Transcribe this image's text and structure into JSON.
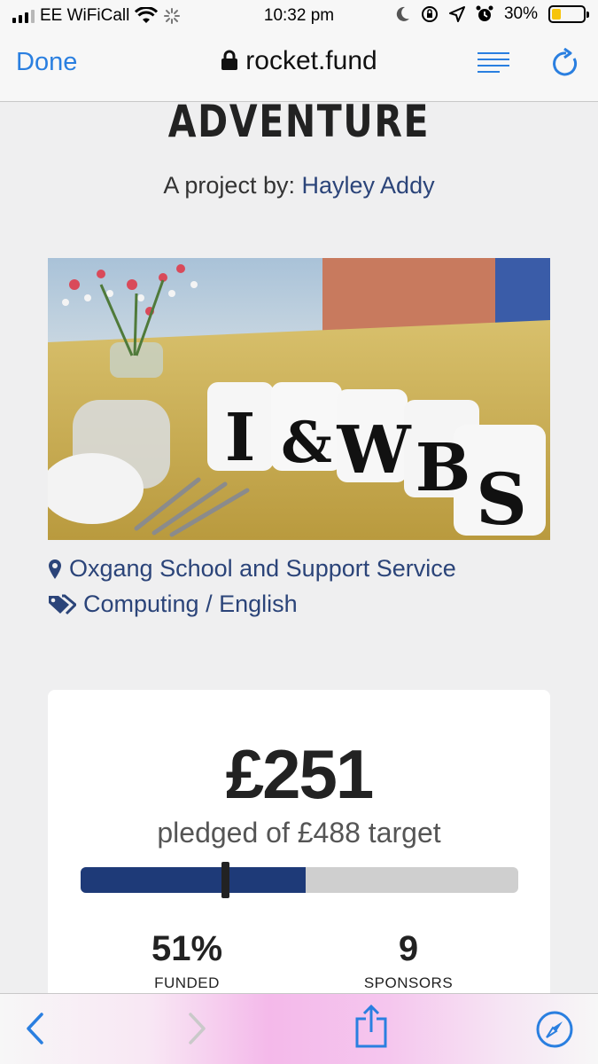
{
  "status_bar": {
    "carrier": "EE WiFiCall",
    "time": "10:32 pm",
    "battery_percent": "30%",
    "battery_level": 0.3,
    "battery_color": "#f7c40a"
  },
  "nav": {
    "done_label": "Done",
    "url": "rocket.fund",
    "accent_color": "#2a7fe0"
  },
  "project": {
    "title": "ADVENTURE",
    "byline_prefix": "A project by:",
    "author": "Hayley Addy",
    "photo_letters": [
      "I",
      "&",
      "W",
      "B",
      "S"
    ],
    "location": "Oxgang School and Support Service",
    "categories": "Computing / English"
  },
  "funding": {
    "pledged": "£251",
    "target_text": "pledged of £488 target",
    "progress_fraction": 0.514,
    "marker_fraction": 0.33,
    "bar_color": "#1e3a78",
    "funded_value": "51%",
    "funded_label": "FUNDED",
    "sponsors_value": "9",
    "sponsors_label": "SPONSORS"
  },
  "toolbar": {
    "icons": [
      "back-icon",
      "forward-icon",
      "share-icon",
      "compass-icon"
    ]
  }
}
